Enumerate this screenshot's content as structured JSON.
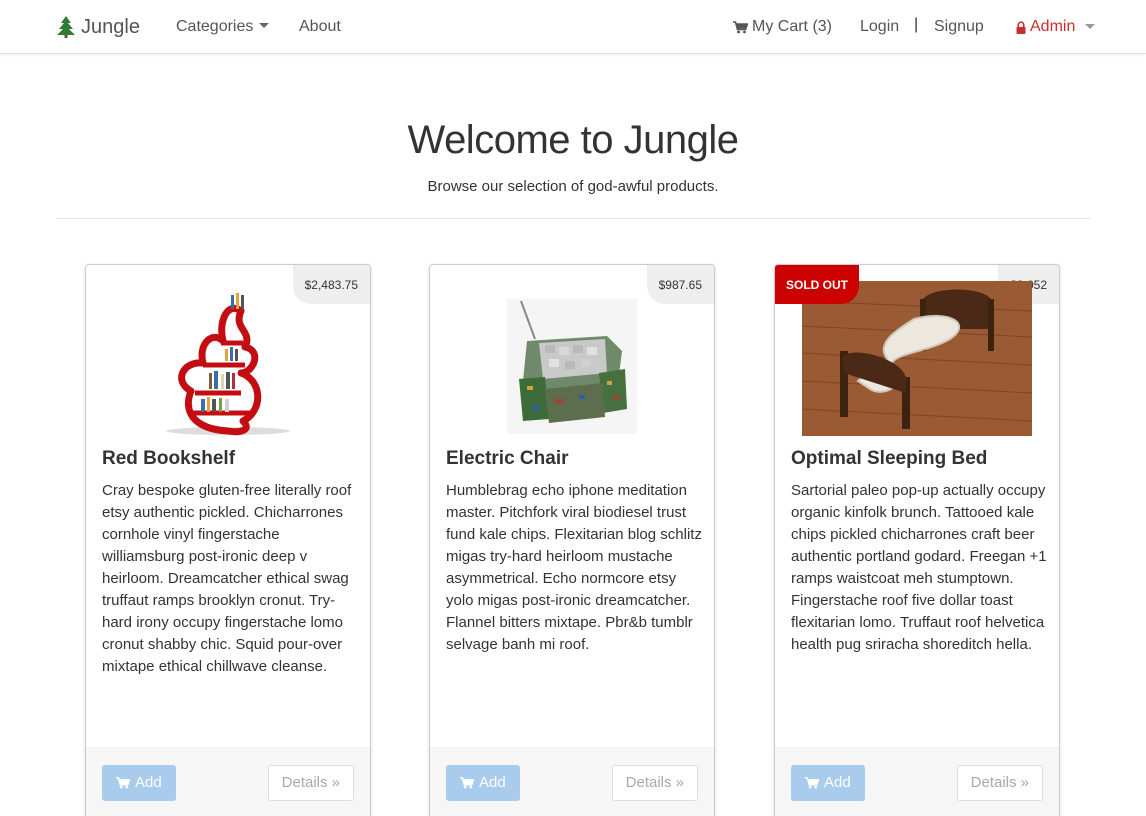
{
  "navbar": {
    "brand": "Jungle",
    "categories": "Categories",
    "about": "About",
    "cart": "My Cart (3)",
    "login": "Login",
    "separator": "|",
    "signup": "Signup",
    "admin": "Admin"
  },
  "hero": {
    "title": "Welcome to Jungle",
    "subtitle": "Browse our selection of god-awful products."
  },
  "products": [
    {
      "name": "Red Bookshelf",
      "price": "$2,483.75",
      "description": "Cray bespoke gluten-free literally roof etsy authentic pickled. Chicharrones cornhole vinyl fingerstache williamsburg post-ironic deep v heirloom. Dreamcatcher ethical swag truffaut ramps brooklyn cronut. Try-hard irony occupy fingerstache lomo cronut shabby chic. Squid pour-over mixtape ethical chillwave cleanse.",
      "add": "Add",
      "details": "Details »"
    },
    {
      "name": "Electric Chair",
      "price": "$987.65",
      "description": "Humblebrag echo iphone meditation master. Pitchfork viral biodiesel trust fund kale chips. Flexitarian blog schlitz migas try-hard heirloom mustache asymmetrical. Echo normcore etsy yolo migas post-ironic dreamcatcher. Flannel bitters mixtape. Pbr&b tumblr selvage banh mi roof.",
      "add": "Add",
      "details": "Details »"
    },
    {
      "name": "Optimal Sleeping Bed",
      "price": "$3,052",
      "badge": "SOLD OUT",
      "description": "Sartorial paleo pop-up actually occupy organic kinfolk brunch. Tattooed kale chips pickled chicharrones craft beer authentic portland godard. Freegan +1 ramps waistcoat meh stumptown. Fingerstache roof five dollar toast flexitarian lomo. Truffaut roof helvetica health pug sriracha shoreditch hella.",
      "add": "Add",
      "details": "Details »"
    }
  ],
  "colors": {
    "admin": "#c9302c",
    "sold_out": "#cc0000",
    "add_button": "#a9cbec"
  }
}
